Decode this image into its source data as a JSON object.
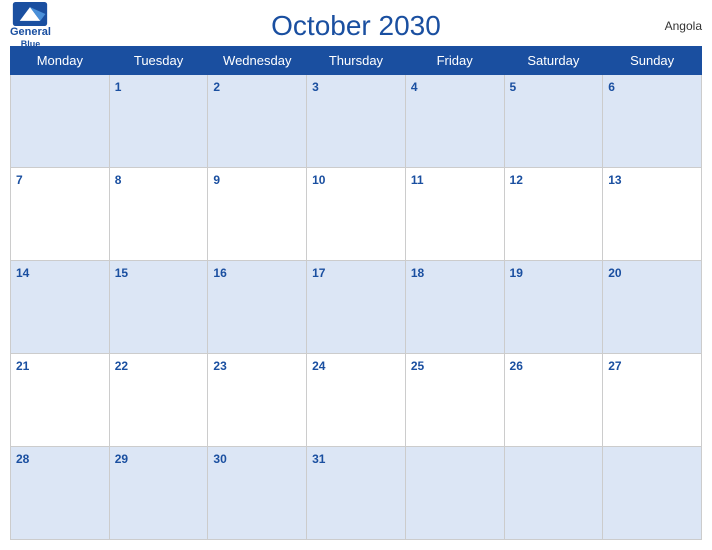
{
  "header": {
    "title": "October 2030",
    "country": "Angola",
    "logo_brand": "General",
    "logo_sub": "Blue"
  },
  "days_of_week": [
    "Monday",
    "Tuesday",
    "Wednesday",
    "Thursday",
    "Friday",
    "Saturday",
    "Sunday"
  ],
  "weeks": [
    [
      "",
      "1",
      "2",
      "3",
      "4",
      "5",
      "6"
    ],
    [
      "7",
      "8",
      "9",
      "10",
      "11",
      "12",
      "13"
    ],
    [
      "14",
      "15",
      "16",
      "17",
      "18",
      "19",
      "20"
    ],
    [
      "21",
      "22",
      "23",
      "24",
      "25",
      "26",
      "27"
    ],
    [
      "28",
      "29",
      "30",
      "31",
      "",
      "",
      ""
    ]
  ]
}
